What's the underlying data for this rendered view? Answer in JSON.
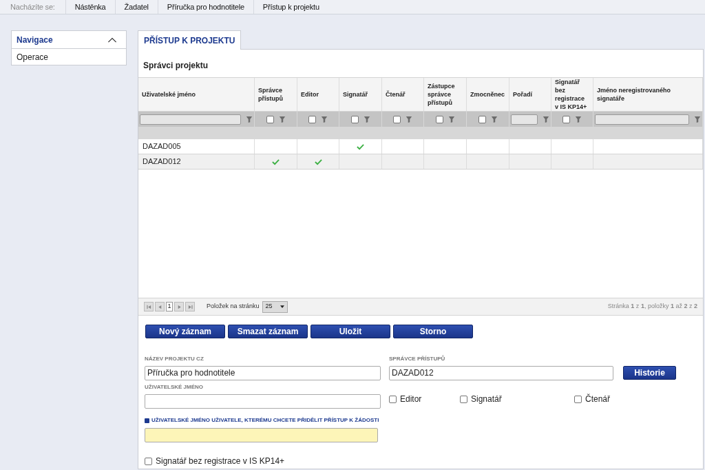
{
  "breadcrumb": {
    "label": "Nacházíte se:",
    "items": [
      "Nástěnka",
      "Žadatel",
      "Příručka pro hodnotitele",
      "Přístup k projektu"
    ]
  },
  "sidebar": {
    "title": "Navigace",
    "expanded": true,
    "items": [
      "Operace"
    ]
  },
  "tab": {
    "label": "PŘÍSTUP K PROJEKTU"
  },
  "table": {
    "title": "Správci projektu",
    "columns": [
      {
        "label": "Uživatelské jméno",
        "kind": "text"
      },
      {
        "label": "Správce přístupů",
        "kind": "check",
        "checked": false
      },
      {
        "label": "Editor",
        "kind": "check",
        "checked": false
      },
      {
        "label": "Signatář",
        "kind": "check",
        "checked": false
      },
      {
        "label": "Čtenář",
        "kind": "check",
        "checked": false
      },
      {
        "label": "Zástupce správce přístupů",
        "kind": "check",
        "checked": false
      },
      {
        "label": "Zmocněnec",
        "kind": "check",
        "checked": false
      },
      {
        "label": "Pořadí",
        "kind": "text"
      },
      {
        "label": "Signatář bez registrace v IS KP14+",
        "kind": "check",
        "checked": false
      },
      {
        "label": "Jméno neregistrovaného signatáře",
        "kind": "text"
      }
    ],
    "rows": [
      {
        "username": "DAZAD005",
        "selected": false,
        "checks": [
          false,
          false,
          true,
          false,
          false,
          false,
          false
        ]
      },
      {
        "username": "DAZAD012",
        "selected": true,
        "checks": [
          true,
          true,
          false,
          false,
          false,
          false,
          false
        ]
      }
    ]
  },
  "pager": {
    "page": "1",
    "per_page_label": "Položek na stránku",
    "per_page": "25",
    "summary": "Stránka **1** z **1**, položky **1** až **2** z **2**"
  },
  "buttons": [
    "Nový záznam",
    "Smazat záznam",
    "Uložit",
    "Storno"
  ],
  "form": {
    "project_name": {
      "label": "NÁZEV PROJEKTU CZ",
      "value": "Příručka pro hodnotitele"
    },
    "access_admin": {
      "label": "SPRÁVCE PŘÍSTUPŮ",
      "value": "DAZAD012"
    },
    "history_button": "Historie",
    "username": {
      "label": "UŽIVATELSKÉ JMÉNO"
    },
    "roles": [
      {
        "label": "Editor",
        "checked": false
      },
      {
        "label": "Signatář",
        "checked": false
      },
      {
        "label": "Čtenář",
        "checked": false
      }
    ],
    "grant": {
      "label": "UŽIVATELSKÉ JMÉNO UŽIVATELE, KTERÉMU CHCETE PŘIDĚLIT PŘÍSTUP K ŽÁDOSTI",
      "required": true
    },
    "unregistered": {
      "label": "Signatář bez registrace v IS KP14+",
      "checked": false
    }
  }
}
